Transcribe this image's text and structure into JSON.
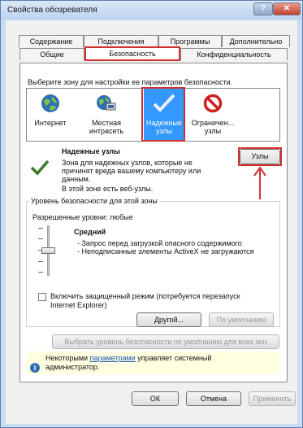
{
  "window": {
    "title": "Свойства обозревателя",
    "help": "?",
    "close": "✕"
  },
  "tabs": {
    "row1": [
      "Содержание",
      "Подключения",
      "Программы",
      "Дополнительно"
    ],
    "row2": [
      "Общие",
      "Безопасность",
      "Конфиденциальность"
    ],
    "selected": "Безопасность"
  },
  "security": {
    "zone_prompt": "Выберите зону для настройки ее параметров безопасности.",
    "zones": [
      {
        "line1": "Интернет",
        "line2": "",
        "icon": "globe-icon"
      },
      {
        "line1": "Местная",
        "line2": "интрасеть",
        "icon": "intranet-icon"
      },
      {
        "line1": "Надежные",
        "line2": "узлы",
        "icon": "checkmark-icon"
      },
      {
        "line1": "Ограничен...",
        "line2": "узлы",
        "icon": "no-entry-icon"
      }
    ],
    "selected_zone": "Надежные узлы",
    "zone_title": "Надежные узлы",
    "zone_desc": [
      "Зона для надежных узлов, которые не",
      "причинят вреда вашему компьютеру или",
      "данным."
    ],
    "zone_note": "В этой зоне есть веб-узлы.",
    "sites_button": "Узлы",
    "group_title": "Уровень безопасности для этой зоны",
    "allowed_levels": "Разрешенные уровни: любые",
    "level_name": "Средний",
    "level_points": [
      "- Запрос перед загрузкой опасного содержимого",
      "- Неподписанные элементы ActiveX не загружаются"
    ],
    "protected_mode_label": [
      "Включить защищенный режим (потребуется перезапуск",
      "Internet Explorer)"
    ],
    "custom_button": "Другой...",
    "default_button": "По умолчанию",
    "reset_all_button": "Выбрать уровень безопасности по умолчанию для всех зон",
    "info_prefix": "Некоторыми ",
    "info_link": "параметрами",
    "info_suffix": " управляет системный",
    "info_line2": "администратор."
  },
  "footer": {
    "ok": "ОК",
    "cancel": "Отмена",
    "apply": "Применить"
  },
  "colors": {
    "annotation": "#d0302f",
    "selection": "#3399ff"
  }
}
